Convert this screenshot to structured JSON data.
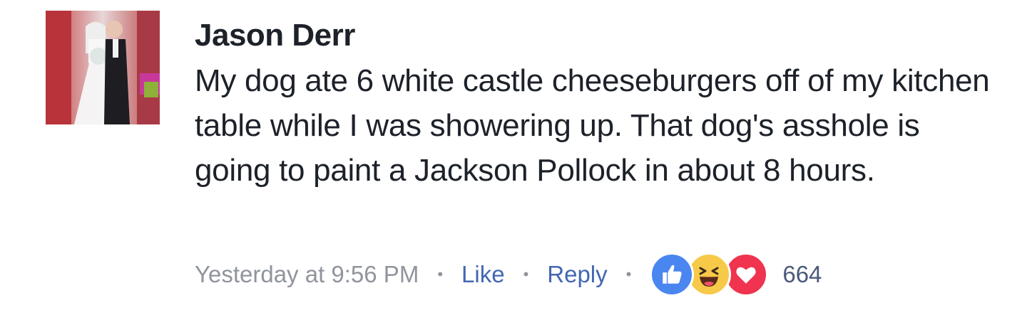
{
  "comment": {
    "author": "Jason Derr",
    "text": "My dog ate 6 white castle cheeseburgers off of my kitchen table while I was showering up. That dog's asshole is going to paint a Jackson Pollock in about 8 hours.",
    "timestamp": "Yesterday at 9:56 PM",
    "like_label": "Like",
    "reply_label": "Reply",
    "separator": "•",
    "reaction_count": "664",
    "reactions": [
      "like-icon",
      "haha-icon",
      "love-icon"
    ]
  },
  "colors": {
    "author": "#1d2129",
    "link": "#4267b2",
    "meta": "#90949c",
    "like_reaction": "#4a86f0",
    "haha_reaction": "#f7c948",
    "love_reaction": "#f0334e"
  }
}
